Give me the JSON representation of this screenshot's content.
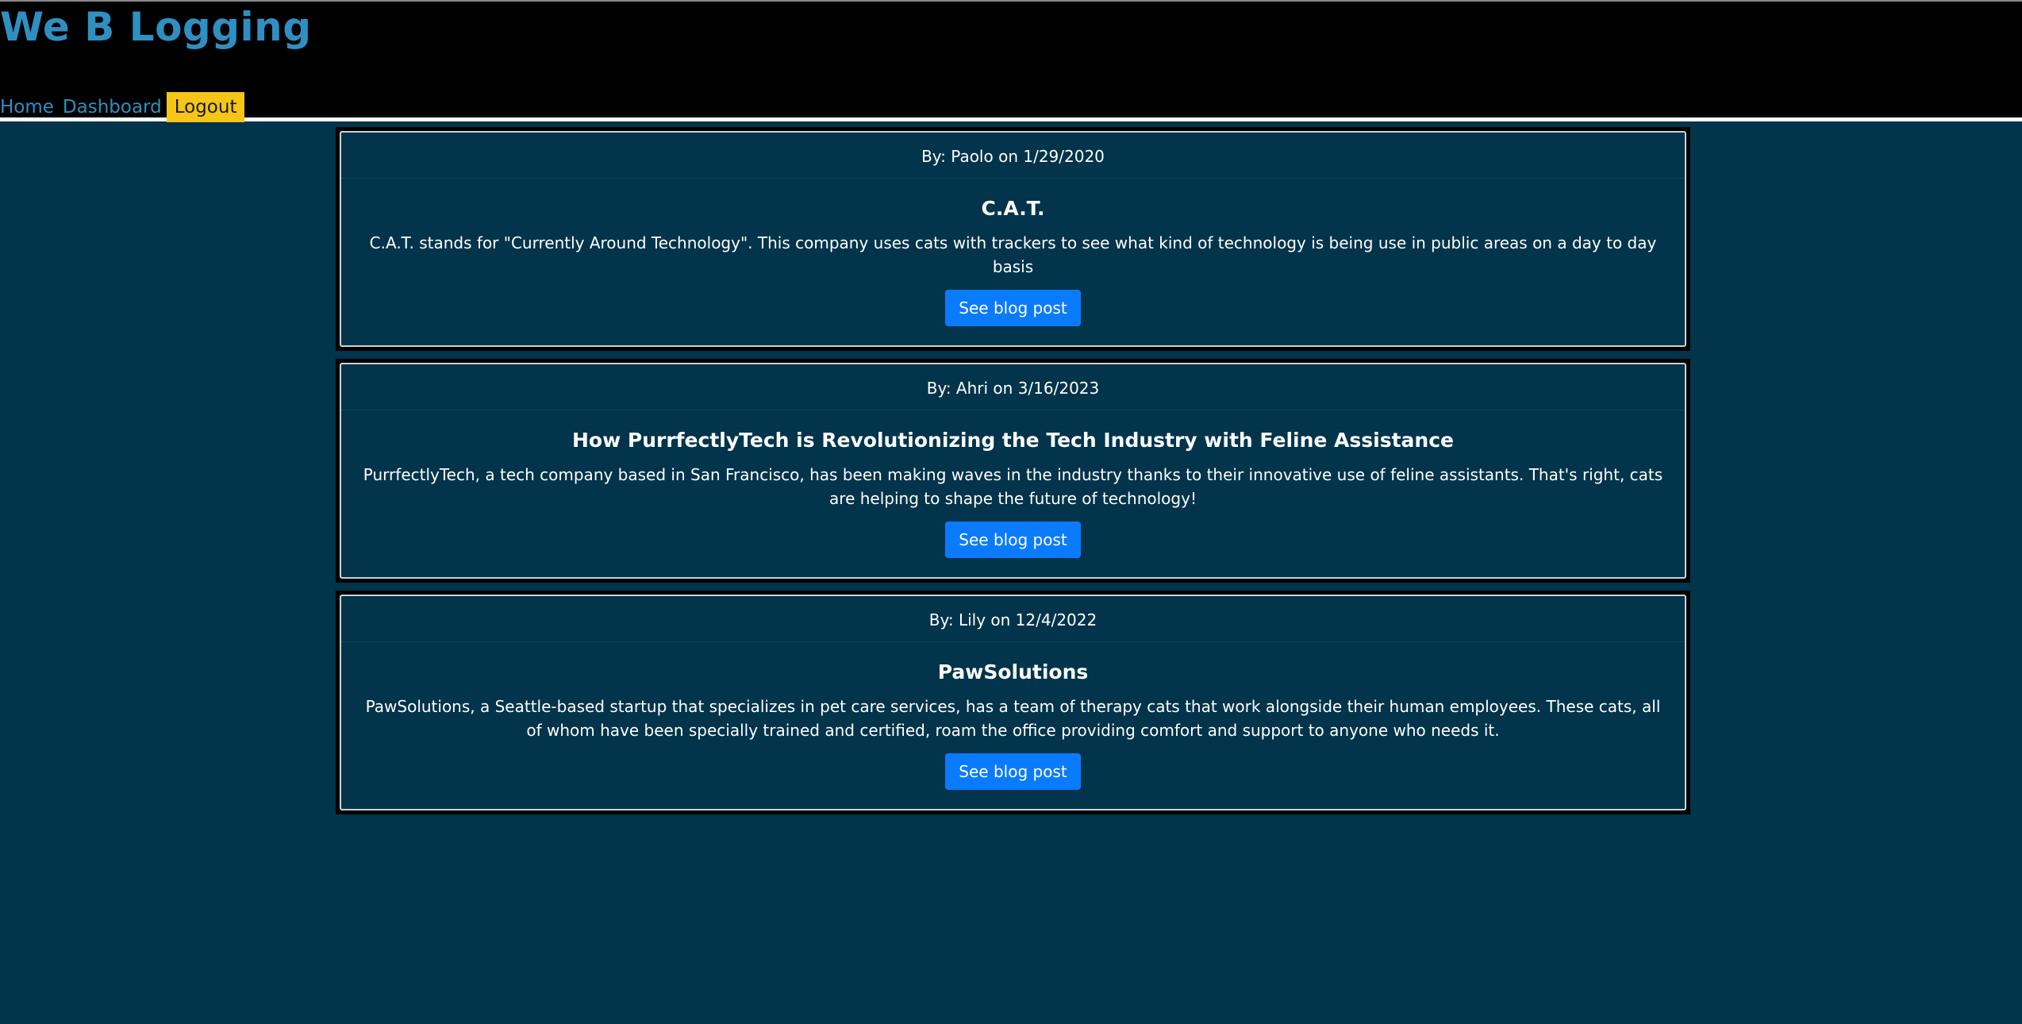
{
  "site": {
    "title": "We B Logging"
  },
  "nav": {
    "home": "Home",
    "dashboard": "Dashboard",
    "logout": "Logout"
  },
  "posts": [
    {
      "meta": "By: Paolo on 1/29/2020",
      "title": "C.A.T.",
      "text": "C.A.T. stands for \"Currently Around Technology\". This company uses cats with trackers to see what kind of technology is being use in public areas on a day to day basis",
      "button": "See blog post"
    },
    {
      "meta": "By: Ahri on 3/16/2023",
      "title": "How PurrfectlyTech is Revolutionizing the Tech Industry with Feline Assistance",
      "text": "PurrfectlyTech, a tech company based in San Francisco, has been making waves in the industry thanks to their innovative use of feline assistants. That's right, cats are helping to shape the future of technology!",
      "button": "See blog post"
    },
    {
      "meta": "By: Lily on 12/4/2022",
      "title": "PawSolutions",
      "text": "PawSolutions, a Seattle-based startup that specializes in pet care services, has a team of therapy cats that work alongside their human employees. These cats, all of whom have been specially trained and certified, roam the office providing comfort and support to anyone who needs it.",
      "button": "See blog post"
    }
  ],
  "colors": {
    "page_background": "#02344b",
    "header_background": "#000000",
    "title_color": "#2f8fc1",
    "logout_background": "#f5c518",
    "button_background": "#0a7bfc"
  }
}
